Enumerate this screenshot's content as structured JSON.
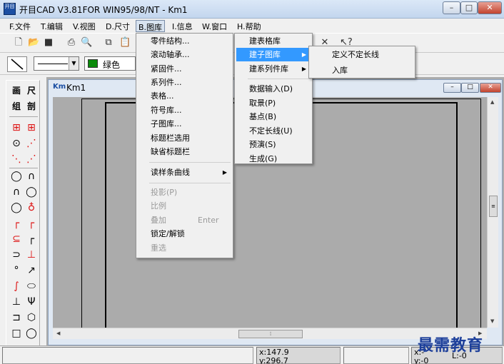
{
  "window": {
    "title": "开目CAD V3.81FOR WIN95/98/NT - Km1",
    "icon": "开目",
    "min": "–",
    "max": "□",
    "close": "✕"
  },
  "menubar": [
    {
      "label": "F.文件"
    },
    {
      "label": "T.编辑"
    },
    {
      "label": "V.视图"
    },
    {
      "label": "D.尺寸"
    },
    {
      "label": "B.图库"
    },
    {
      "label": "I.信息"
    },
    {
      "label": "W.窗口"
    },
    {
      "label": "H.帮助"
    }
  ],
  "toolbar": {
    "color_label": "绿色",
    "accent_color": "#0a8a0a",
    "icons": [
      "new-icon",
      "open-icon",
      "save-icon",
      "print-icon",
      "print-preview-icon",
      "copy-icon",
      "paste-icon"
    ]
  },
  "palette": {
    "text1": "画",
    "text2": "尺",
    "text3": "组",
    "text4": "剖"
  },
  "child": {
    "title": "Km1",
    "icon": "Km"
  },
  "library_menu": [
    {
      "label": "零件结构..."
    },
    {
      "label": "滚动轴承..."
    },
    {
      "label": "紧固件..."
    },
    {
      "label": "系列件..."
    },
    {
      "label": "表格..."
    },
    {
      "label": "符号库..."
    },
    {
      "label": "子图库..."
    },
    {
      "label": "标题栏选用"
    },
    {
      "label": "缺省标题栏"
    },
    {
      "label": "读样条曲线"
    },
    {
      "label": "投影(P)",
      "disabled": true
    },
    {
      "label": "比例",
      "disabled": true
    },
    {
      "label": "叠加",
      "shortcut": "Enter",
      "disabled": true
    },
    {
      "label": "锁定/解锁"
    },
    {
      "label": "重选",
      "disabled": true
    }
  ],
  "sub_menu": [
    {
      "label": "建表格库"
    },
    {
      "label": "建子图库"
    },
    {
      "label": "建系列件库"
    },
    {
      "label": "数据输入(D)"
    },
    {
      "label": "取景(P)"
    },
    {
      "label": "基点(B)"
    },
    {
      "label": "不定长线(U)"
    },
    {
      "label": "预演(S)"
    },
    {
      "label": "生成(G)"
    }
  ],
  "sub_menu2": [
    {
      "label": "定义不定长线"
    },
    {
      "label": "入库"
    }
  ],
  "status": {
    "x": "x:147.9",
    "y": "y:296.7",
    "rx": "x:-",
    "ry": "y:-0",
    "rl": "L:-0"
  },
  "watermark": "最需教育"
}
